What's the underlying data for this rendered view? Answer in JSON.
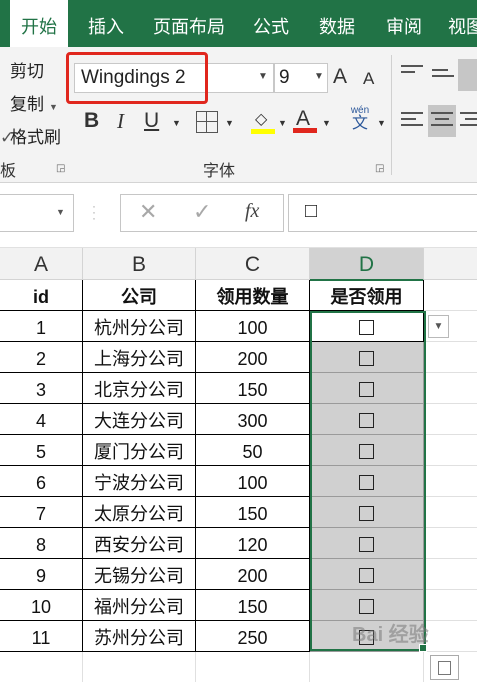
{
  "tabs": [
    "开始",
    "插入",
    "页面布局",
    "公式",
    "数据",
    "审阅",
    "视图"
  ],
  "clipboard": {
    "cut": "剪切",
    "copy": "复制",
    "format_painter": "格式刷",
    "group_label": "板"
  },
  "font": {
    "name": "Wingdings 2",
    "size": "9",
    "group_label": "字体",
    "bold": "B",
    "italic": "I",
    "underline": "U",
    "grow": "A",
    "shrink": "A",
    "color_glyph": "A",
    "phonetic_top": "wén",
    "phonetic_bottom": "文"
  },
  "formula_bar": {
    "cancel": "✕",
    "enter": "✓",
    "fx": "fx",
    "content": "□"
  },
  "columns": [
    "A",
    "B",
    "C",
    "D"
  ],
  "table": {
    "headers": [
      "id",
      "公司",
      "领用数量",
      "是否领用"
    ],
    "rows": [
      [
        "1",
        "杭州分公司",
        "100",
        "□"
      ],
      [
        "2",
        "上海分公司",
        "200",
        "□"
      ],
      [
        "3",
        "北京分公司",
        "150",
        "□"
      ],
      [
        "4",
        "大连分公司",
        "300",
        "□"
      ],
      [
        "5",
        "厦门分公司",
        "50",
        "□"
      ],
      [
        "6",
        "宁波分公司",
        "100",
        "□"
      ],
      [
        "7",
        "太原分公司",
        "150",
        "□"
      ],
      [
        "8",
        "西安分公司",
        "120",
        "□"
      ],
      [
        "9",
        "无锡分公司",
        "200",
        "□"
      ],
      [
        "10",
        "福州分公司",
        "150",
        "□"
      ],
      [
        "11",
        "苏州分公司",
        "250",
        "□"
      ]
    ]
  },
  "watermark": "Bai 经验",
  "colors": {
    "accent": "#217346",
    "highlight": "#e0261d",
    "selection_fill": "#d0d0d0"
  }
}
